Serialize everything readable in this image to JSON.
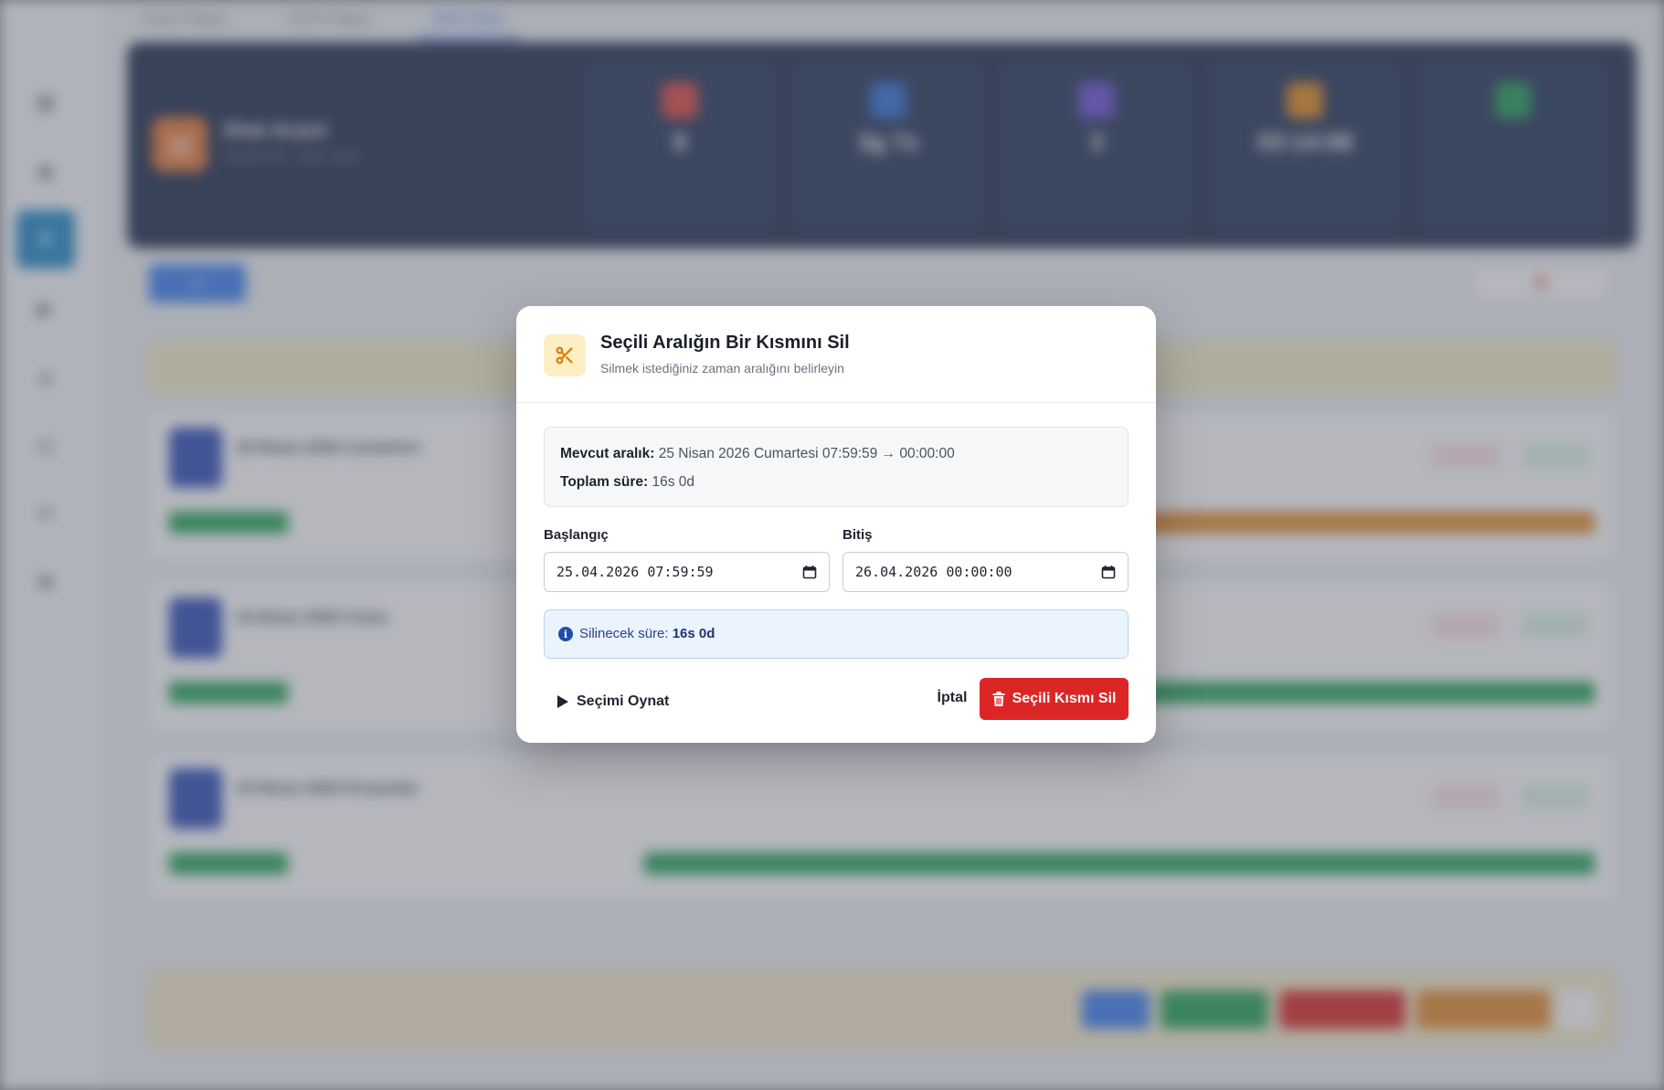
{
  "background": {
    "tabs": [
      "Canlı Player",
      "DVR Player",
      "Disk Arşivi"
    ],
    "hero": {
      "title": "Disk Arşivi",
      "subtitle": "arşivlenmiş · kayıt arşivi",
      "stats": [
        {
          "value": "8",
          "color": "#e0463f"
        },
        {
          "value": "3g 7s",
          "color": "#2f6fd6"
        },
        {
          "value": "3",
          "color": "#6b4fd8"
        },
        {
          "value": "03:14:08",
          "color": "#e38a1c"
        },
        {
          "value": "",
          "color": "#1f9d55"
        }
      ]
    },
    "days": [
      {
        "title": "25 Nisan 2026 Cumartesi",
        "right_bar_color": "#e58a2a"
      },
      {
        "title": "24 Nisan 2026 Cuma",
        "right_bar_color": "#22a354"
      },
      {
        "title": "23 Nisan 2026 Perşembe",
        "right_bar_color": "#22a354"
      }
    ]
  },
  "modal": {
    "icon": "scissors-icon",
    "title": "Seçili Aralığın Bir Kısmını Sil",
    "subtitle": "Silmek istediğiniz zaman aralığını belirleyin",
    "current_range_label": "Mevcut aralık:",
    "current_range_value": "25 Nisan 2026 Cumartesi 07:59:59 → 00:00:00",
    "total_label": "Toplam süre:",
    "total_value": "16s 0d",
    "start_label": "Başlangıç",
    "start_value": "25.04.2026 07:59:59",
    "end_label": "Bitiş",
    "end_value": "26.04.2026 00:00:00",
    "delete_duration_label": "Silinecek süre:",
    "delete_duration_value": "16s 0d",
    "play_button": "Seçimi Oynat",
    "cancel_button": "İptal",
    "delete_button": "Seçili Kısmı Sil",
    "colors": {
      "danger": "#dc2626",
      "icon_bg": "#fdefc3",
      "icon_fg": "#d9820f",
      "info_bg": "#ebf3fd"
    }
  }
}
